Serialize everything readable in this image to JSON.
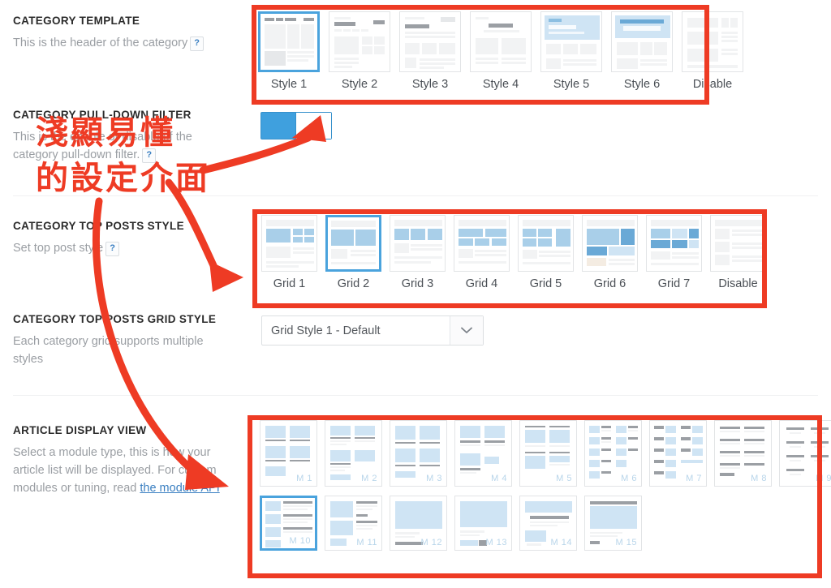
{
  "sections": [
    {
      "id": "category-template",
      "title": "CATEGORY TEMPLATE",
      "desc": "This is the header of the category",
      "help": "?"
    },
    {
      "id": "category-pull-down-filter",
      "title": "CATEGORY PULL-DOWN FILTER",
      "desc_line1": "This is the enable or disable of the",
      "desc_line2": "category pull-down filter.",
      "help": "?"
    },
    {
      "id": "category-top-posts-style",
      "title": "CATEGORY TOP POSTS STYLE",
      "desc": "Set top post style",
      "help": "?"
    },
    {
      "id": "category-top-posts-grid-style",
      "title": "CATEGORY TOP POSTS GRID STYLE",
      "desc": "Each category grid supports multiple styles"
    },
    {
      "id": "article-display-view",
      "title": "ARTICLE DISPLAY VIEW",
      "desc_pre": "Select a module type, this is how your article list will be displayed. For custom modules or tuning, read ",
      "link_text": "the module API"
    }
  ],
  "template_styles": [
    {
      "label": "Style 1",
      "selected": true
    },
    {
      "label": "Style 2",
      "selected": false
    },
    {
      "label": "Style 3",
      "selected": false
    },
    {
      "label": "Style 4",
      "selected": false
    },
    {
      "label": "Style 5",
      "selected": false
    },
    {
      "label": "Style 6",
      "selected": false
    },
    {
      "label": "Disable",
      "selected": false
    }
  ],
  "pull_down_filter": {
    "state": "on",
    "on_color": "#3fa0de"
  },
  "top_posts_styles": [
    {
      "label": "Grid 1",
      "selected": false
    },
    {
      "label": "Grid 2",
      "selected": true
    },
    {
      "label": "Grid 3",
      "selected": false
    },
    {
      "label": "Grid 4",
      "selected": false
    },
    {
      "label": "Grid 5",
      "selected": false
    },
    {
      "label": "Grid 6",
      "selected": false
    },
    {
      "label": "Grid 7",
      "selected": false
    },
    {
      "label": "Disable",
      "selected": false
    }
  ],
  "grid_style_select": {
    "value": "Grid Style 1 - Default",
    "icon": "chevron-down-icon"
  },
  "article_modules_row1": [
    {
      "label": "M 1",
      "selected": false
    },
    {
      "label": "M 2",
      "selected": false
    },
    {
      "label": "M 3",
      "selected": false
    },
    {
      "label": "M 4",
      "selected": false
    },
    {
      "label": "M 5",
      "selected": false
    },
    {
      "label": "M 6",
      "selected": false
    },
    {
      "label": "M 7",
      "selected": false
    },
    {
      "label": "M 8",
      "selected": false
    },
    {
      "label": "M 9",
      "selected": false
    }
  ],
  "article_modules_row2": [
    {
      "label": "M 10",
      "selected": true
    },
    {
      "label": "M 11",
      "selected": false
    },
    {
      "label": "M 12",
      "selected": false
    },
    {
      "label": "M 13",
      "selected": false
    },
    {
      "label": "M 14",
      "selected": false
    },
    {
      "label": "M 15",
      "selected": false
    }
  ],
  "annotations": {
    "cjk_line1": "淺顯易懂",
    "cjk_line2": "的設定介面",
    "color": "#ee3b24"
  }
}
